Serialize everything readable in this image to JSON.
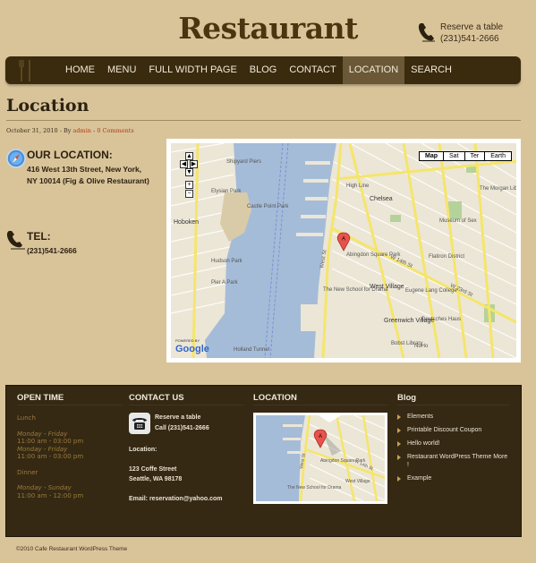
{
  "header": {
    "site_title": "Restaurant",
    "reserve_label": "Reserve a table",
    "reserve_phone": "(231)541-2666"
  },
  "nav": {
    "items": [
      {
        "label": "HOME",
        "active": false
      },
      {
        "label": "MENU",
        "active": false
      },
      {
        "label": "FULL WIDTH PAGE",
        "active": false
      },
      {
        "label": "BLOG",
        "active": false
      },
      {
        "label": "CONTACT",
        "active": false
      },
      {
        "label": "LOCATION",
        "active": true
      },
      {
        "label": "SEARCH",
        "active": false
      }
    ]
  },
  "page": {
    "title": "Location",
    "meta_date": "October 31, 2010",
    "meta_by": "By",
    "meta_author": "admin",
    "meta_comments": "0 Comments",
    "location_heading": "OUR LOCATION:",
    "location_line1": "416 West 13th Street, New York,",
    "location_line2": "NY 10014 (Fig & Olive Restaurant)",
    "tel_heading": "TEL:",
    "tel_value": "(231)541-2666"
  },
  "map": {
    "type_buttons": [
      "Map",
      "Sat",
      "Ter",
      "Earth"
    ],
    "active_type": "Map",
    "marker_label": "A",
    "labels": [
      "Hoboken",
      "Elysian Park",
      "Castle Point Park",
      "Shipyard Piers",
      "Chelsea",
      "High Line",
      "West Village",
      "Abingdon Square Park",
      "Flatiron District",
      "Eugene Lang College",
      "Greenwich Village",
      "Deutsches Haus",
      "The New School for Drama",
      "Museum of Sex",
      "The Morgan Library & Museum",
      "Pier A Park",
      "Hudson Park",
      "NoHo",
      "Bobst Library",
      "W 14th St",
      "W 23rd St",
      "West St",
      "Holland Tunnel"
    ],
    "powered_by": "POWERED BY",
    "google": "Google"
  },
  "footer": {
    "open_time": {
      "heading": "OPEN TIME",
      "lunch_label": "Lunch",
      "lunch_rows": [
        {
          "days": "Monday - Friday",
          "hours": "11:00 am - 03:00 pm"
        },
        {
          "days": "Monday - Friday",
          "hours": "11:00 am - 03:00 pm"
        }
      ],
      "dinner_label": "Dinner",
      "dinner_rows": [
        {
          "days": "Monday - Sunday",
          "hours": "11:00 am - 12:00 pm"
        }
      ]
    },
    "contact": {
      "heading": "CONTACT US",
      "reserve_label": "Reserve a table",
      "call": "Call (231)541-2666",
      "location_label": "Location:",
      "address_line1": "123 Coffe Street",
      "address_line2": "Seattle, WA 98178",
      "email": "Email: reservation@yahoo.com"
    },
    "location": {
      "heading": "LOCATION",
      "marker_label": "A",
      "labels": [
        "Abingdon Square Park",
        "West Village",
        "The New School for Drama",
        "W 14th St",
        "West St"
      ]
    },
    "blog": {
      "heading": "Blog",
      "items": [
        "Elements",
        "Printable Discount Coupon",
        "Hello world!",
        "Restaurant WordPress Theme More !",
        "Example"
      ]
    }
  },
  "copyright": "©2010 Cafe Restaurant WordPress Theme",
  "colors": {
    "background": "#d9c49a",
    "nav_bg": "#3a2a0e",
    "nav_active": "#6a5836",
    "footer_bg": "#352914",
    "link_accent": "#b33a10",
    "open_time_text": "#9b7a3a",
    "water": "#a5bcd8",
    "road_yellow": "#f5e56b"
  }
}
